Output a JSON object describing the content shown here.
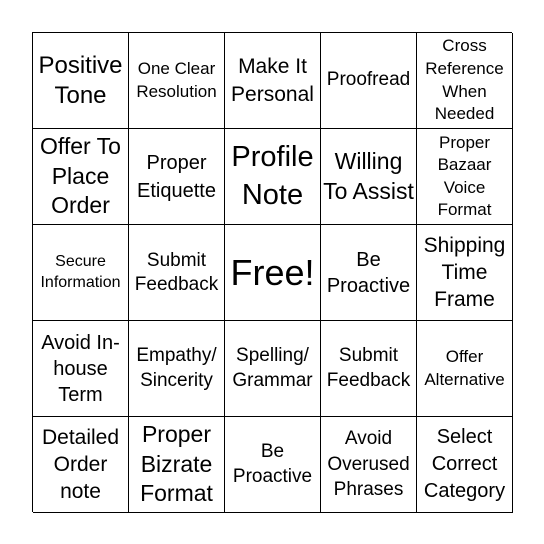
{
  "card": {
    "cells": [
      "Positive Tone",
      "One Clear Resolution",
      "Make It Personal",
      "Proofread",
      "Cross Reference When Needed",
      "Offer To Place Order",
      "Proper Etiquette",
      "Profile Note",
      "Willing To Assist",
      "Proper Bazaar Voice Format",
      "Secure Information",
      "Submit Feedback",
      "Free!",
      "Be Proactive",
      "Shipping Time Frame",
      "Avoid In-house Term",
      "Empathy/ Sincerity",
      "Spelling/ Grammar",
      "Submit Feedback",
      "Offer Alternative",
      "Detailed Order note",
      "Proper Bizrate Format",
      "Be Proactive",
      "Avoid Overused Phrases",
      "Select Correct Category"
    ]
  }
}
